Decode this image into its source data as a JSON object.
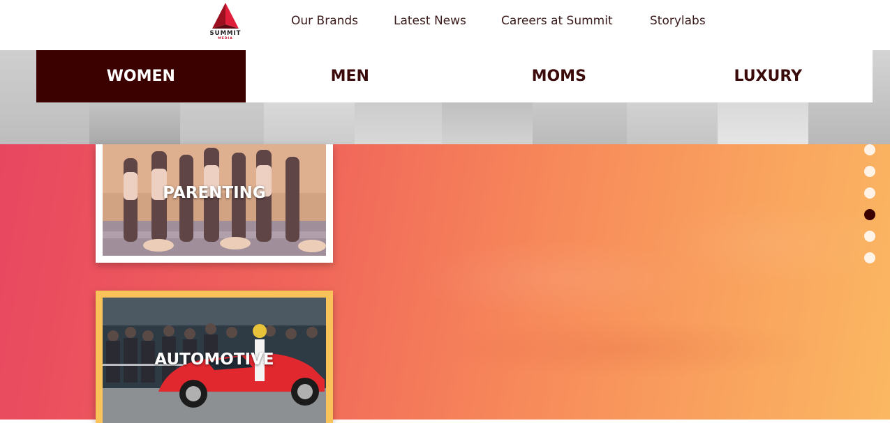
{
  "brand": {
    "logo_text": "SUMMIT",
    "logo_subtext": "MEDIA"
  },
  "topnav": {
    "items": [
      {
        "label": "Our Brands"
      },
      {
        "label": "Latest News"
      },
      {
        "label": "Careers at Summit"
      },
      {
        "label": "Storylabs"
      }
    ]
  },
  "tabs": [
    {
      "label": "WOMEN",
      "active": true
    },
    {
      "label": "MEN",
      "active": false
    },
    {
      "label": "MOMS",
      "active": false
    },
    {
      "label": "LUXURY",
      "active": false
    }
  ],
  "cards": [
    {
      "label": "PARENTING"
    },
    {
      "label": "AUTOMOTIVE"
    }
  ],
  "dots": {
    "count": 6,
    "active_index": 3
  },
  "colors": {
    "accent_dark": "#3b0000",
    "gradient_start": "#e84660",
    "gradient_end": "#fbb862",
    "card_gold": "#f9c35a"
  }
}
